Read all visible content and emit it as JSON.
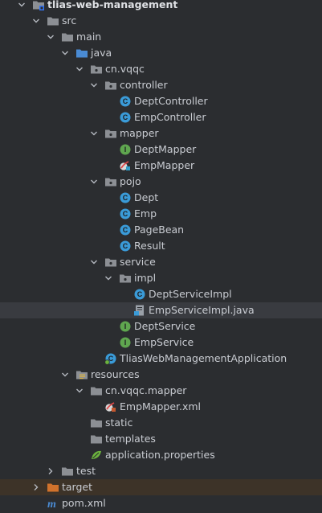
{
  "project_tree": {
    "items": [
      {
        "label": "tlias-web-management",
        "depth": 0,
        "expander": "open",
        "icon": "module-folder-icon",
        "bold": true
      },
      {
        "label": "src",
        "depth": 1,
        "expander": "open",
        "icon": "folder-icon"
      },
      {
        "label": "main",
        "depth": 2,
        "expander": "open",
        "icon": "folder-icon"
      },
      {
        "label": "java",
        "depth": 3,
        "expander": "open",
        "icon": "source-folder-icon"
      },
      {
        "label": "cn.vqqc",
        "depth": 4,
        "expander": "open",
        "icon": "package-icon"
      },
      {
        "label": "controller",
        "depth": 5,
        "expander": "open",
        "icon": "package-icon"
      },
      {
        "label": "DeptController",
        "depth": 6,
        "expander": "none",
        "icon": "class-icon"
      },
      {
        "label": "EmpController",
        "depth": 6,
        "expander": "none",
        "icon": "class-icon"
      },
      {
        "label": "mapper",
        "depth": 5,
        "expander": "open",
        "icon": "package-icon"
      },
      {
        "label": "DeptMapper",
        "depth": 6,
        "expander": "none",
        "icon": "interface-icon"
      },
      {
        "label": "EmpMapper",
        "depth": 6,
        "expander": "none",
        "icon": "mybatis-mapper-icon"
      },
      {
        "label": "pojo",
        "depth": 5,
        "expander": "open",
        "icon": "package-icon"
      },
      {
        "label": "Dept",
        "depth": 6,
        "expander": "none",
        "icon": "class-icon"
      },
      {
        "label": "Emp",
        "depth": 6,
        "expander": "none",
        "icon": "class-icon"
      },
      {
        "label": "PageBean",
        "depth": 6,
        "expander": "none",
        "icon": "class-icon"
      },
      {
        "label": "Result",
        "depth": 6,
        "expander": "none",
        "icon": "class-icon"
      },
      {
        "label": "service",
        "depth": 5,
        "expander": "open",
        "icon": "package-icon"
      },
      {
        "label": "impl",
        "depth": 6,
        "expander": "open",
        "icon": "package-icon"
      },
      {
        "label": "DeptServiceImpl",
        "depth": 7,
        "expander": "none",
        "icon": "class-icon"
      },
      {
        "label": "EmpServiceImpl.java",
        "depth": 7,
        "expander": "none",
        "icon": "java-file-icon",
        "selected": true
      },
      {
        "label": "DeptService",
        "depth": 6,
        "expander": "none",
        "icon": "interface-icon"
      },
      {
        "label": "EmpService",
        "depth": 6,
        "expander": "none",
        "icon": "interface-icon"
      },
      {
        "label": "TliasWebManagementApplication",
        "depth": 5,
        "expander": "none",
        "icon": "spring-boot-class-icon"
      },
      {
        "label": "resources",
        "depth": 3,
        "expander": "open",
        "icon": "resources-folder-icon"
      },
      {
        "label": "cn.vqqc.mapper",
        "depth": 4,
        "expander": "open",
        "icon": "folder-icon"
      },
      {
        "label": "EmpMapper.xml",
        "depth": 5,
        "expander": "none",
        "icon": "mybatis-xml-icon"
      },
      {
        "label": "static",
        "depth": 4,
        "expander": "none",
        "icon": "folder-icon"
      },
      {
        "label": "templates",
        "depth": 4,
        "expander": "none",
        "icon": "folder-icon"
      },
      {
        "label": "application.properties",
        "depth": 4,
        "expander": "none",
        "icon": "spring-properties-icon"
      },
      {
        "label": "test",
        "depth": 2,
        "expander": "closed",
        "icon": "folder-icon"
      },
      {
        "label": "target",
        "depth": 1,
        "expander": "closed",
        "icon": "excluded-folder-icon",
        "highlight": "excluded"
      },
      {
        "label": "pom.xml",
        "depth": 1,
        "expander": "none",
        "icon": "maven-pom-icon"
      }
    ]
  },
  "colors": {
    "background": "#2b2d30",
    "text": "#c9ccd2",
    "selection": "#393b40",
    "excluded_row": "#3d3328",
    "folder": "#8c8f94",
    "source_folder": "#4a8bd4",
    "excluded_folder": "#d0722c",
    "class_icon": "#3a9bd8",
    "interface_icon": "#5fa64f",
    "maven_icon": "#4a8bd4"
  }
}
